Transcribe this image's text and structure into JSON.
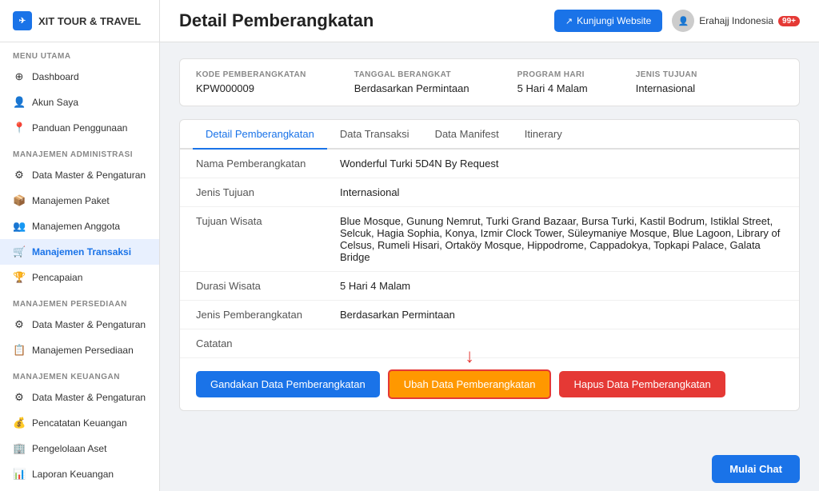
{
  "sidebar": {
    "logo_text": "XIT TOUR & TRAVEL",
    "sections": [
      {
        "title": "MENU UTAMA",
        "items": [
          {
            "id": "dashboard",
            "label": "Dashboard",
            "icon": "⊕",
            "active": false
          },
          {
            "id": "akun-saya",
            "label": "Akun Saya",
            "icon": "👤",
            "active": false
          },
          {
            "id": "panduan",
            "label": "Panduan Penggunaan",
            "icon": "📍",
            "active": false
          }
        ]
      },
      {
        "title": "MANAJEMEN ADMINISTRASI",
        "items": [
          {
            "id": "data-master-admin",
            "label": "Data Master & Pengaturan",
            "icon": "⚙",
            "active": false
          },
          {
            "id": "manajemen-paket",
            "label": "Manajemen Paket",
            "icon": "📦",
            "active": false
          },
          {
            "id": "manajemen-anggota",
            "label": "Manajemen Anggota",
            "icon": "👥",
            "active": false
          },
          {
            "id": "manajemen-transaksi",
            "label": "Manajemen Transaksi",
            "icon": "🛒",
            "active": true
          },
          {
            "id": "pencapaian",
            "label": "Pencapaian",
            "icon": "🏆",
            "active": false
          }
        ]
      },
      {
        "title": "MANAJEMEN PERSEDIAAN",
        "items": [
          {
            "id": "data-master-persediaan",
            "label": "Data Master & Pengaturan",
            "icon": "⚙",
            "active": false
          },
          {
            "id": "manajemen-persediaan",
            "label": "Manajemen Persediaan",
            "icon": "📋",
            "active": false
          }
        ]
      },
      {
        "title": "MANAJEMEN KEUANGAN",
        "items": [
          {
            "id": "data-master-keuangan",
            "label": "Data Master & Pengaturan",
            "icon": "⚙",
            "active": false
          },
          {
            "id": "pencatatan-keuangan",
            "label": "Pencatatan Keuangan",
            "icon": "💰",
            "active": false
          },
          {
            "id": "pengelolaan-aset",
            "label": "Pengelolaan Aset",
            "icon": "🏢",
            "active": false
          },
          {
            "id": "laporan-keuangan",
            "label": "Laporan Keuangan",
            "icon": "📊",
            "active": false
          }
        ]
      }
    ]
  },
  "header": {
    "title": "Detail Pemberangkatan",
    "btn_website_label": "Kunjungi Website",
    "user_name": "Erahajj Indonesia",
    "badge_count": "99+"
  },
  "info_bar": {
    "fields": [
      {
        "id": "kode",
        "label": "KODE PEMBERANGKATAN",
        "value": "KPW000009"
      },
      {
        "id": "tanggal",
        "label": "TANGGAL BERANGKAT",
        "value": "Berdasarkan Permintaan"
      },
      {
        "id": "program",
        "label": "PROGRAM HARI",
        "value": "5 Hari 4 Malam"
      },
      {
        "id": "jenis",
        "label": "JENIS TUJUAN",
        "value": "Internasional"
      }
    ]
  },
  "tabs": [
    {
      "id": "detail",
      "label": "Detail Pemberangkatan",
      "active": true
    },
    {
      "id": "transaksi",
      "label": "Data Transaksi",
      "active": false
    },
    {
      "id": "manifest",
      "label": "Data Manifest",
      "active": false
    },
    {
      "id": "itinerary",
      "label": "Itinerary",
      "active": false
    }
  ],
  "detail": {
    "rows": [
      {
        "id": "nama",
        "label": "Nama Pemberangkatan",
        "value": "Wonderful Turki 5D4N By Request"
      },
      {
        "id": "jenis-tujuan",
        "label": "Jenis Tujuan",
        "value": "Internasional"
      },
      {
        "id": "tujuan-wisata",
        "label": "Tujuan Wisata",
        "value": "Blue Mosque, Gunung Nemrut, Turki Grand Bazaar, Bursa Turki, Kastil Bodrum, Istiklal Street, Selcuk, Hagia Sophia, Konya, Izmir Clock Tower, Süleymaniye Mosque, Blue Lagoon, Library of Celsus, Rumeli Hisari, Ortaköy Mosque, Hippodrome, Cappadokya, Topkapi Palace, Galata Bridge"
      },
      {
        "id": "durasi",
        "label": "Durasi Wisata",
        "value": "5 Hari 4 Malam"
      },
      {
        "id": "jenis-pemberangkatan",
        "label": "Jenis Pemberangkatan",
        "value": "Berdasarkan Permintaan"
      },
      {
        "id": "catatan",
        "label": "Catatan",
        "value": ""
      }
    ]
  },
  "buttons": {
    "gandakan": "Gandakan Data Pemberangkatan",
    "ubah": "Ubah Data Pemberangkatan",
    "hapus": "Hapus Data Pemberangkatan"
  },
  "mulai_chat": "Mulai Chat"
}
